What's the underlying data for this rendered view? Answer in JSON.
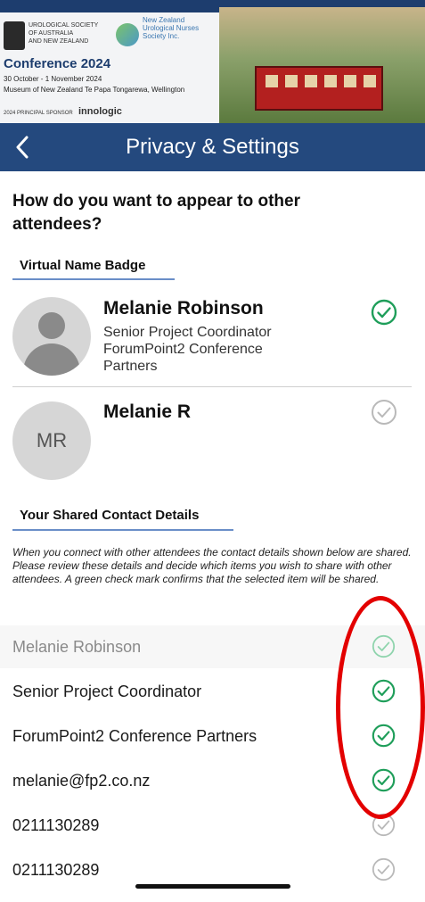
{
  "banner": {
    "society_line1": "UROLOGICAL SOCIETY",
    "society_line2": "OF AUSTRALIA",
    "society_line3": "AND NEW ZEALAND",
    "nurses_line1": "New Zealand",
    "nurses_line2": "Urological Nurses",
    "nurses_line3": "Society Inc.",
    "conference_title": "Conference 2024",
    "conference_dates": "30 October - 1 November 2024",
    "conference_venue": "Museum of New Zealand Te Papa Tongarewa, Wellington",
    "sponsor_label": "2024 PRINCIPAL SPONSOR",
    "sponsor_name": "innologic"
  },
  "header": {
    "back_icon": "chevron-left-icon",
    "title": "Privacy & Settings"
  },
  "question": "How do you want to appear to other attendees?",
  "name_badge": {
    "section_title": "Virtual Name Badge",
    "options": [
      {
        "name": "Melanie Robinson",
        "line1": "Senior Project Coordinator",
        "line2": "ForumPoint2 Conference",
        "line3": "Partners",
        "selected": true
      },
      {
        "name": "Melanie R",
        "initials": "MR",
        "selected": false
      }
    ]
  },
  "contact": {
    "section_title": "Your Shared Contact Details",
    "explanation": "When you connect with other attendees the contact details shown below are shared. Please review these details and decide which items you wish to share with other attendees. A green check mark confirms that the selected item will be shared.",
    "items": [
      {
        "label": "Melanie Robinson",
        "shared": true,
        "disabled": true
      },
      {
        "label": "Senior Project Coordinator",
        "shared": true,
        "disabled": false
      },
      {
        "label": "ForumPoint2 Conference Partners",
        "shared": true,
        "disabled": false
      },
      {
        "label": "melanie@fp2.co.nz",
        "shared": true,
        "disabled": false
      },
      {
        "label": "0211130289",
        "shared": false,
        "disabled": false
      },
      {
        "label": "0211130289",
        "shared": false,
        "disabled": false
      }
    ]
  },
  "colors": {
    "navy": "#24497e",
    "check_on": "#1f9e5a",
    "check_off": "#b9b9b9",
    "check_disabled": "#8fd4ad",
    "annotation": "#e30000"
  }
}
